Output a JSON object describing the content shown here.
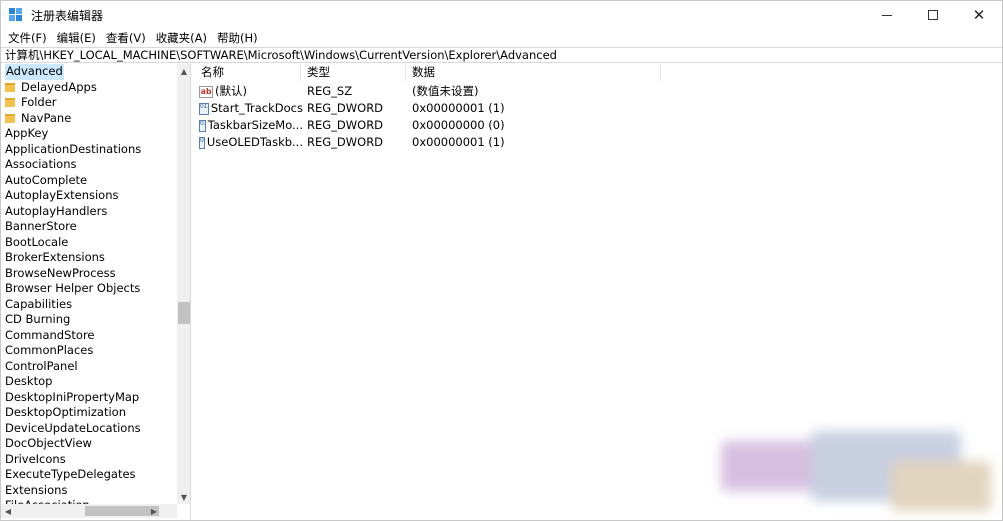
{
  "window": {
    "title": "注册表编辑器",
    "controls": {
      "minimize": "",
      "maximize": "",
      "close": "✕"
    }
  },
  "menu": [
    "文件(F)",
    "编辑(E)",
    "查看(V)",
    "收藏夹(A)",
    "帮助(H)"
  ],
  "address": "计算机\\HKEY_LOCAL_MACHINE\\SOFTWARE\\Microsoft\\Windows\\CurrentVersion\\Explorer\\Advanced",
  "tree": {
    "selected": "Advanced",
    "children": [
      "DelayedApps",
      "Folder",
      "NavPane"
    ],
    "siblings": [
      "AppKey",
      "ApplicationDestinations",
      "Associations",
      "AutoComplete",
      "AutoplayExtensions",
      "AutoplayHandlers",
      "BannerStore",
      "BootLocale",
      "BrokerExtensions",
      "BrowseNewProcess",
      "Browser Helper Objects",
      "Capabilities",
      "CD Burning",
      "CommandStore",
      "CommonPlaces",
      "ControlPanel",
      "Desktop",
      "DesktopIniPropertyMap",
      "DesktopOptimization",
      "DeviceUpdateLocations",
      "DocObjectView",
      "DriveIcons",
      "ExecuteTypeDelegates",
      "Extensions",
      "FileAssociation"
    ],
    "scroll_up_glyph": "▲",
    "scroll_down_glyph": "▼",
    "scroll_left_glyph": "◀",
    "scroll_right_glyph": "▶"
  },
  "values": {
    "headers": {
      "name": "名称",
      "type": "类型",
      "data": "数据"
    },
    "rows": [
      {
        "icon": "string-value-icon",
        "glyph": "ab",
        "name": "(默认)",
        "type": "REG_SZ",
        "data": "(数值未设置)"
      },
      {
        "icon": "binary-value-icon",
        "glyph": "011 110",
        "name": "Start_TrackDocs",
        "type": "REG_DWORD",
        "data": "0x00000001 (1)"
      },
      {
        "icon": "binary-value-icon",
        "glyph": "011 110",
        "name": "TaskbarSizeMo...",
        "type": "REG_DWORD",
        "data": "0x00000000 (0)"
      },
      {
        "icon": "binary-value-icon",
        "glyph": "011 110",
        "name": "UseOLEDTaskb...",
        "type": "REG_DWORD",
        "data": "0x00000001 (1)"
      }
    ]
  },
  "colors": {
    "accent_selection": "#cce8ff",
    "folder": "#f2c14e",
    "app_icon": "#2b86d8"
  }
}
